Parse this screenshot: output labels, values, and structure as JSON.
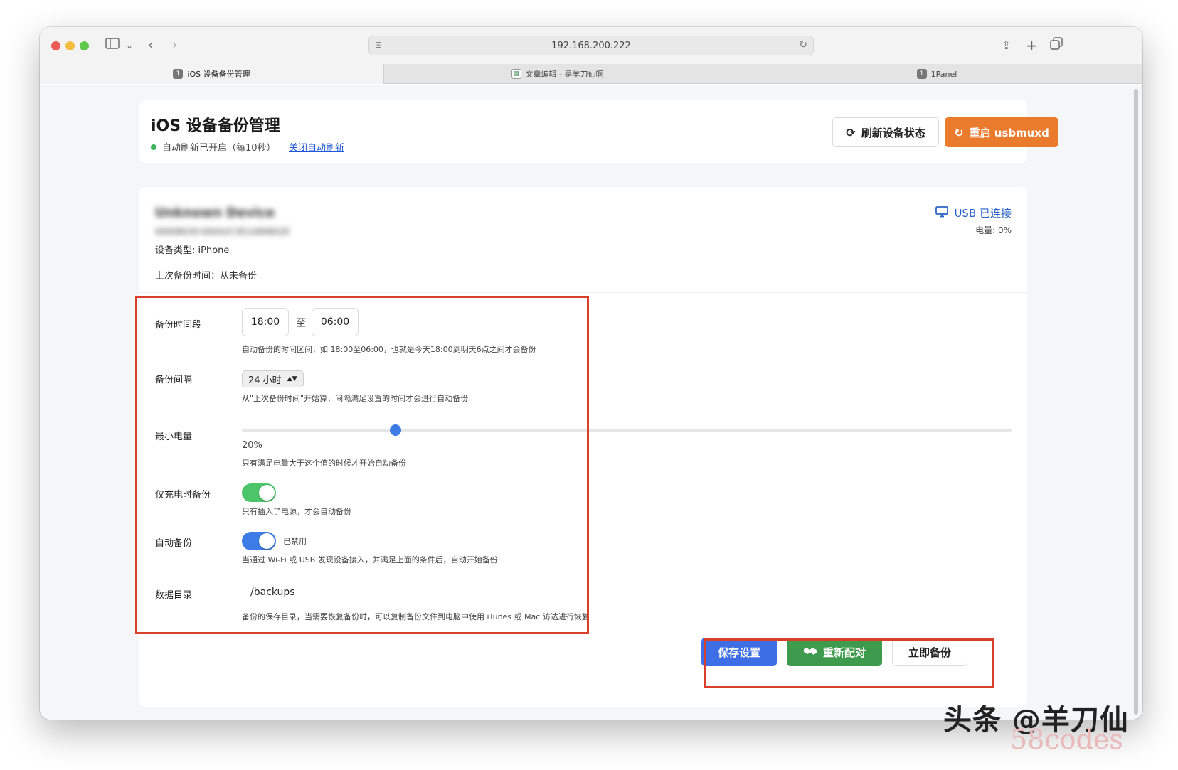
{
  "browser": {
    "url": "192.168.200.222",
    "tabs": [
      {
        "num": "1",
        "label": "iOS 设备备份管理",
        "active": true
      },
      {
        "num": "",
        "label": "文章编辑 - 是羊刀仙啊",
        "active": false
      },
      {
        "num": "1",
        "label": "1Panel",
        "active": false
      }
    ]
  },
  "header": {
    "title": "iOS 设备备份管理",
    "auto_refresh_status": "自动刷新已开启（每10秒）",
    "close_auto_refresh": "关闭自动刷新",
    "refresh_button": "刷新设备状态",
    "restart_button": "重启 usbmuxd"
  },
  "device": {
    "name_blurred": "Unknown Device",
    "id_blurred": "00008030-000A2C3E1A89802E",
    "type_label": "设备类型: iPhone",
    "last_backup": "上次备份时间：从未备份",
    "connection": "USB 已连接",
    "battery": "电量: 0%"
  },
  "settings": {
    "time_range_label": "备份时间段",
    "time_start": "18:00",
    "time_sep": "至",
    "time_end": "06:00",
    "time_hint": "自动备份的时间区间，如 18:00至06:00，也就是今天18:00到明天6点之间才会备份",
    "interval_label": "备份间隔",
    "interval_value": "24 小时",
    "interval_hint": "从\"上次备份时间\"开始算，间隔满足设置的时间才会进行自动备份",
    "min_battery_label": "最小电量",
    "min_battery_value": "20%",
    "min_battery_fraction": 0.2,
    "min_battery_hint": "只有满足电量大于这个值的时候才开始自动备份",
    "charging_only_label": "仅充电时备份",
    "charging_only_on": true,
    "charging_only_hint": "只有插入了电源，才会自动备份",
    "auto_backup_label": "自动备份",
    "auto_backup_state": "已禁用",
    "auto_backup_hint": "当通过 Wi-Fi 或 USB 发现设备接入，并满足上面的条件后，自动开始备份",
    "data_dir_label": "数据目录",
    "data_dir_value": "/backups",
    "data_dir_hint": "备份的保存目录，当需要恢复备份时，可以复制备份文件到电脑中使用 iTunes 或 Mac 访达进行恢复"
  },
  "actions": {
    "save": "保存设置",
    "repair": "重新配对",
    "backup_now": "立即备份"
  },
  "watermark": {
    "line1": "头条 @羊刀仙",
    "line2": "58codes"
  },
  "colors": {
    "orange": "#ea7a2c",
    "blue": "#3d6ee6",
    "green": "#3e9a4c",
    "toggle_green": "#4cc46a",
    "toggle_blue": "#3d7ce6",
    "highlight_red": "#d8402c"
  }
}
